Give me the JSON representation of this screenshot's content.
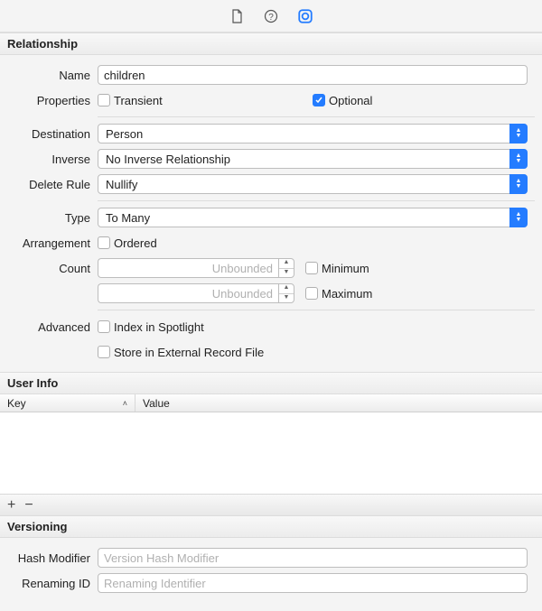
{
  "toolbar": {
    "file_icon": "file",
    "help_icon": "help",
    "inspector_icon": "inspector"
  },
  "relationship": {
    "section_title": "Relationship",
    "name_label": "Name",
    "name_value": "children",
    "properties_label": "Properties",
    "transient_label": "Transient",
    "transient_checked": false,
    "optional_label": "Optional",
    "optional_checked": true,
    "destination_label": "Destination",
    "destination_value": "Person",
    "inverse_label": "Inverse",
    "inverse_value": "No Inverse Relationship",
    "delete_rule_label": "Delete Rule",
    "delete_rule_value": "Nullify",
    "type_label": "Type",
    "type_value": "To Many",
    "arrangement_label": "Arrangement",
    "ordered_label": "Ordered",
    "ordered_checked": false,
    "count_label": "Count",
    "count_min_placeholder": "Unbounded",
    "minimum_label": "Minimum",
    "minimum_checked": false,
    "count_max_placeholder": "Unbounded",
    "maximum_label": "Maximum",
    "maximum_checked": false,
    "advanced_label": "Advanced",
    "index_spotlight_label": "Index in Spotlight",
    "index_spotlight_checked": false,
    "store_external_label": "Store in External Record File",
    "store_external_checked": false
  },
  "user_info": {
    "section_title": "User Info",
    "key_header": "Key",
    "value_header": "Value",
    "add_label": "+",
    "remove_label": "−"
  },
  "versioning": {
    "section_title": "Versioning",
    "hash_modifier_label": "Hash Modifier",
    "hash_modifier_placeholder": "Version Hash Modifier",
    "renaming_id_label": "Renaming ID",
    "renaming_id_placeholder": "Renaming Identifier"
  }
}
